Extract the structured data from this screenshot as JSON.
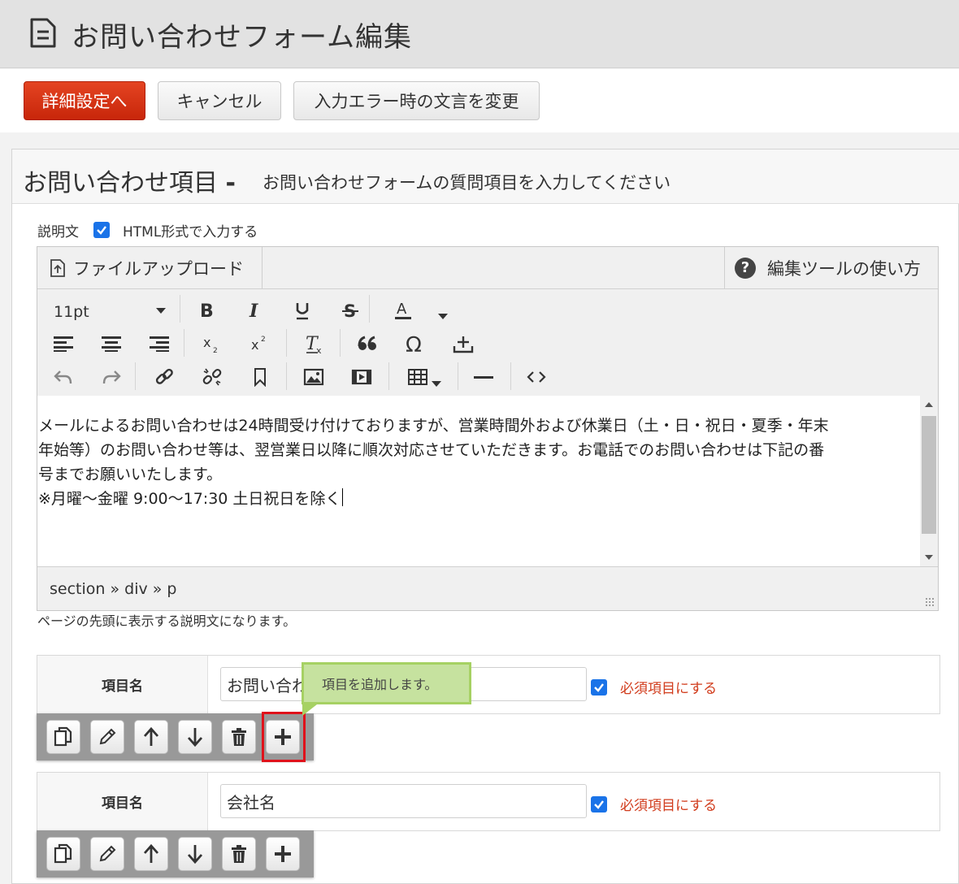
{
  "header": {
    "title": "お問い合わせフォーム編集",
    "icon": "document-icon"
  },
  "toolbar": {
    "detail_label": "詳細設定へ",
    "cancel_label": "キャンセル",
    "error_text_label": "入力エラー時の文言を変更",
    "accent_color": "#d9331a"
  },
  "panel": {
    "title": "お問い合わせ項目",
    "separator": "-",
    "subtitle": "お問い合わせフォームの質問項目を入力してください"
  },
  "description": {
    "label": "説明文",
    "html_checkbox_label": "HTML形式で入力する",
    "html_checked": true,
    "hint": "ページの先頭に表示する説明文になります。"
  },
  "editor": {
    "upload_label": "ファイルアップロード",
    "help_label": "編集ツールの使い方",
    "font_size": "11pt",
    "text_lines": [
      "メールによるお問い合わせは24時間受け付けておりますが、営業時間外および休業日（土・日・祝日・夏季・年末",
      "年始等）のお問い合わせ等は、翌営業日以降に順次対応させていただきます。お電話でのお問い合わせは下記の番",
      "号までお願いいたします。",
      "※月曜～金曜 9:00～17:30 土日祝日を除く"
    ],
    "element_path": "section » div » p"
  },
  "items": [
    {
      "label": "項目名",
      "value": "お問い合わせ",
      "required_label": "必須項目にする",
      "required": true
    },
    {
      "label": "項目名",
      "value": "会社名",
      "required_label": "必須項目にする",
      "required": true
    }
  ],
  "tooltip": {
    "text": "項目を追加します。"
  },
  "colors": {
    "required_text": "#d13c1c",
    "tooltip_bg": "#c6e29f",
    "highlight": "#e0121b",
    "checkbox": "#1a73e8"
  }
}
